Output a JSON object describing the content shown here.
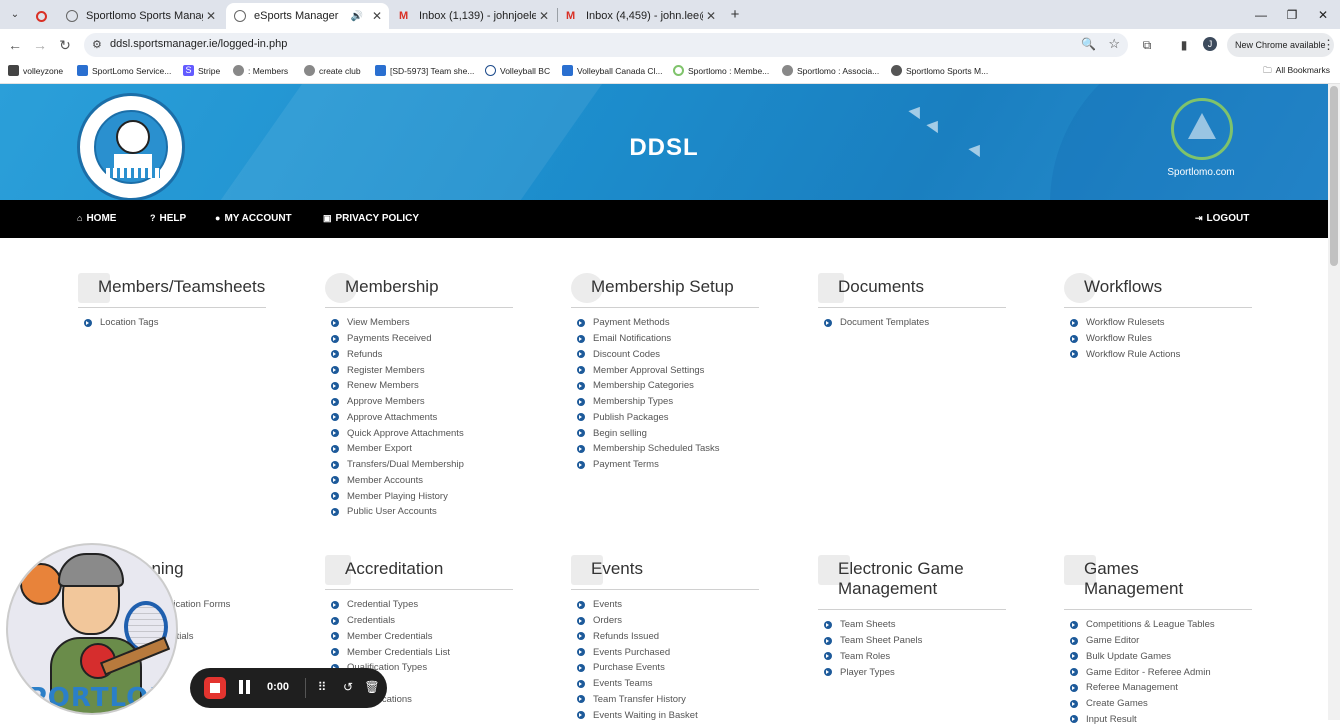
{
  "browser": {
    "tabs": [
      {
        "label": "Sportlomo Sports Manager",
        "active": false
      },
      {
        "label": "eSports Manager",
        "active": true
      },
      {
        "label": "Inbox (1,139) - johnjoelee@gm",
        "active": false
      },
      {
        "label": "Inbox (4,459) - john.lee@sportl",
        "active": false
      }
    ],
    "url": "ddsl.sportsmanager.ie/logged-in.php",
    "profile_initial": "J",
    "update_label": "New Chrome available",
    "bookmarks": [
      {
        "label": "volleyzone",
        "color": "#444"
      },
      {
        "label": "SportLomo Service...",
        "color": "#2a6fd0"
      },
      {
        "label": "Stripe",
        "color": "#635bff"
      },
      {
        "label": ": Members",
        "color": "#777"
      },
      {
        "label": "create club",
        "color": "#777"
      },
      {
        "label": "[SD-5973] Team she...",
        "color": "#2a6fd0"
      },
      {
        "label": "Volleyball BC",
        "color": "#1e4c8c"
      },
      {
        "label": "Volleyball Canada Cl...",
        "color": "#2a6fd0"
      },
      {
        "label": "Sportlomo : Membe...",
        "color": "#7fc36b"
      },
      {
        "label": "Sportlomo : Associa...",
        "color": "#777"
      },
      {
        "label": "Sportlomo Sports M...",
        "color": "#555"
      }
    ],
    "all_bookmarks": "All Bookmarks"
  },
  "header": {
    "title": "DDSL",
    "brand_text": "Sportlomo.com"
  },
  "nav": {
    "home": "HOME",
    "help": "HELP",
    "account": "MY ACCOUNT",
    "privacy": "PRIVACY POLICY",
    "logout": "LOGOUT"
  },
  "modules": [
    {
      "title": "Members/Teamsheets",
      "items": [
        "Location Tags"
      ]
    },
    {
      "title": "Membership",
      "items": [
        "View Members",
        "Payments Received",
        "Refunds",
        "Register Members",
        "Renew Members",
        "Approve Members",
        "Approve Attachments",
        "Quick Approve Attachments",
        "Member Export",
        "Transfers/Dual Membership",
        "Member Accounts",
        "Member Playing History",
        "Public User Accounts"
      ]
    },
    {
      "title": "Membership Setup",
      "items": [
        "Payment Methods",
        "Email Notifications",
        "Discount Codes",
        "Member Approval Settings",
        "Membership Categories",
        "Membership Types",
        "Publish Packages",
        "Begin selling",
        "Membership Scheduled Tasks",
        "Payment Terms"
      ]
    },
    {
      "title": "Documents",
      "items": [
        "Document Templates"
      ]
    },
    {
      "title": "Workflows",
      "items": [
        "Workflow Rulesets",
        "Workflow Rules",
        "Workflow Rule Actions"
      ]
    },
    {
      "title": "oning",
      "items": [
        "plication Forms",
        "ts",
        "entials"
      ]
    },
    {
      "title": "Accreditation",
      "items": [
        "Credential Types",
        "Credentials",
        "Member Credentials",
        "Member Credentials List",
        "Qualification Types",
        "ons",
        "qualifications"
      ]
    },
    {
      "title": "Events",
      "items": [
        "Events",
        "Orders",
        "Refunds Issued",
        "Events Purchased",
        "Purchase Events",
        "Events Teams",
        "Team Transfer History",
        "Events Waiting in Basket"
      ]
    },
    {
      "title_lines": [
        "Electronic Game",
        "Management"
      ],
      "items": [
        "Team Sheets",
        "Team Sheet Panels",
        "Team Roles",
        "Player Types"
      ]
    },
    {
      "title_lines": [
        "Games",
        "Management"
      ],
      "items": [
        "Competitions & League Tables",
        "Game Editor",
        "Bulk Update Games",
        "Game Editor - Referee Admin",
        "Referee Management",
        "Create Games",
        "Input Result"
      ]
    }
  ],
  "mascot": {
    "brand": "SPORTLOMO"
  },
  "recorder": {
    "time": "0:00"
  }
}
